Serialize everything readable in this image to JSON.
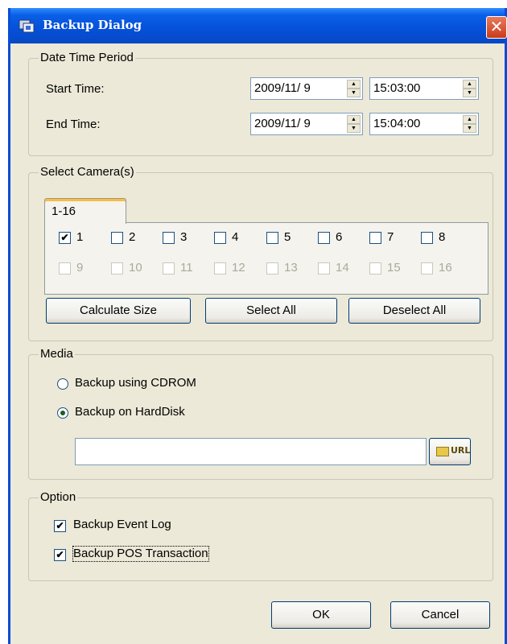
{
  "window": {
    "title": "Backup Dialog",
    "close_glyph": "✕"
  },
  "date_time_period": {
    "label": "Date Time Period",
    "start_label": "Start Time:",
    "start_date": "2009/11/ 9",
    "start_time": "15:03:00",
    "end_label": "End Time:",
    "end_date": "2009/11/ 9",
    "end_time": "15:04:00"
  },
  "select_camera": {
    "label": "Select Camera(s)",
    "tab_label": "1-16",
    "cameras_row1": [
      "1",
      "2",
      "3",
      "4",
      "5",
      "6",
      "7",
      "8"
    ],
    "cameras_row2": [
      "9",
      "10",
      "11",
      "12",
      "13",
      "14",
      "15",
      "16"
    ],
    "checked": [
      "1"
    ],
    "calculate_label": "Calculate Size",
    "select_all_label": "Select All",
    "deselect_all_label": "Deselect All"
  },
  "media": {
    "label": "Media",
    "cdrom_label": "Backup using CDROM",
    "harddisk_label": "Backup on HardDisk",
    "selected": "harddisk",
    "path_value": "",
    "url_label": "URL"
  },
  "option": {
    "label": "Option",
    "event_log_label": "Backup Event Log",
    "event_log_checked": true,
    "pos_label": "Backup POS Transaction",
    "pos_checked": true
  },
  "footer": {
    "ok_label": "OK",
    "cancel_label": "Cancel"
  },
  "icons": {
    "check": "✔",
    "spin_up": "▲",
    "spin_down": "▼"
  }
}
